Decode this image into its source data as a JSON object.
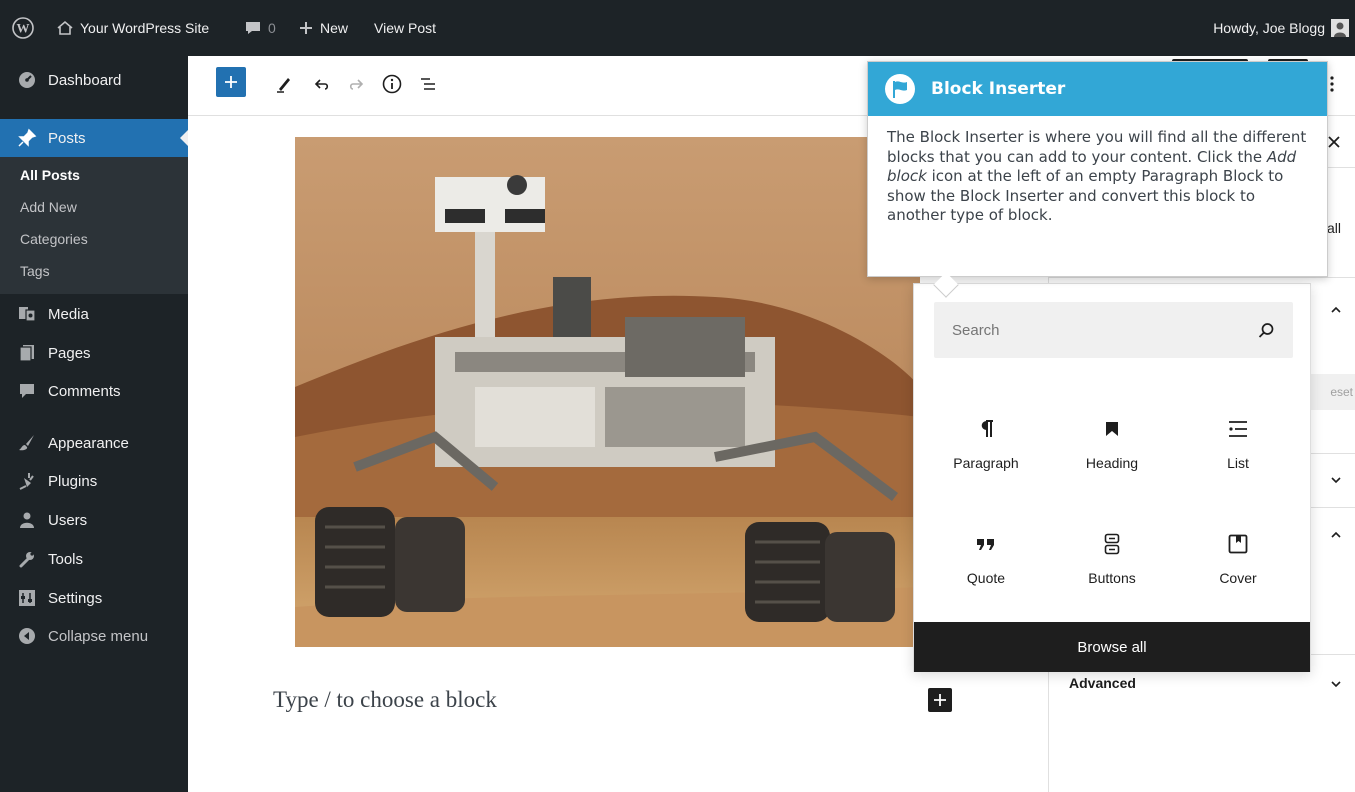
{
  "admin_bar": {
    "site_name": "Your WordPress Site",
    "comment_count": "0",
    "new_label": "New",
    "view_post_label": "View Post",
    "greeting": "Howdy, Joe Blogg"
  },
  "sidebar": {
    "dashboard": "Dashboard",
    "posts": "Posts",
    "submenu": [
      "All Posts",
      "Add New",
      "Categories",
      "Tags"
    ],
    "media": "Media",
    "pages": "Pages",
    "comments": "Comments",
    "appearance": "Appearance",
    "plugins": "Plugins",
    "users": "Users",
    "tools": "Tools",
    "settings": "Settings",
    "collapse": "Collapse menu"
  },
  "editor": {
    "placeholder": "Type / to choose a block"
  },
  "settings_panel": {
    "fragment_all": "all",
    "fragment_reset": "eset",
    "advanced": "Advanced"
  },
  "tour": {
    "title": "Block Inserter",
    "body_before": "The Block Inserter is where you will find all the different blocks that you can add to your content. Click the ",
    "body_emphasis": "Add block",
    "body_after": " icon at the left of an empty Paragraph Block to show the Block Inserter and convert this block to another type of block."
  },
  "inserter": {
    "search_placeholder": "Search",
    "blocks": [
      {
        "label": "Paragraph",
        "icon": "paragraph-icon"
      },
      {
        "label": "Heading",
        "icon": "heading-icon"
      },
      {
        "label": "List",
        "icon": "list-icon"
      },
      {
        "label": "Quote",
        "icon": "quote-icon"
      },
      {
        "label": "Buttons",
        "icon": "buttons-icon"
      },
      {
        "label": "Cover",
        "icon": "cover-icon"
      }
    ],
    "browse_all": "Browse all"
  },
  "colors": {
    "admin_bg": "#1d2327",
    "accent": "#2271b1",
    "tour_header": "#32a7d6"
  }
}
